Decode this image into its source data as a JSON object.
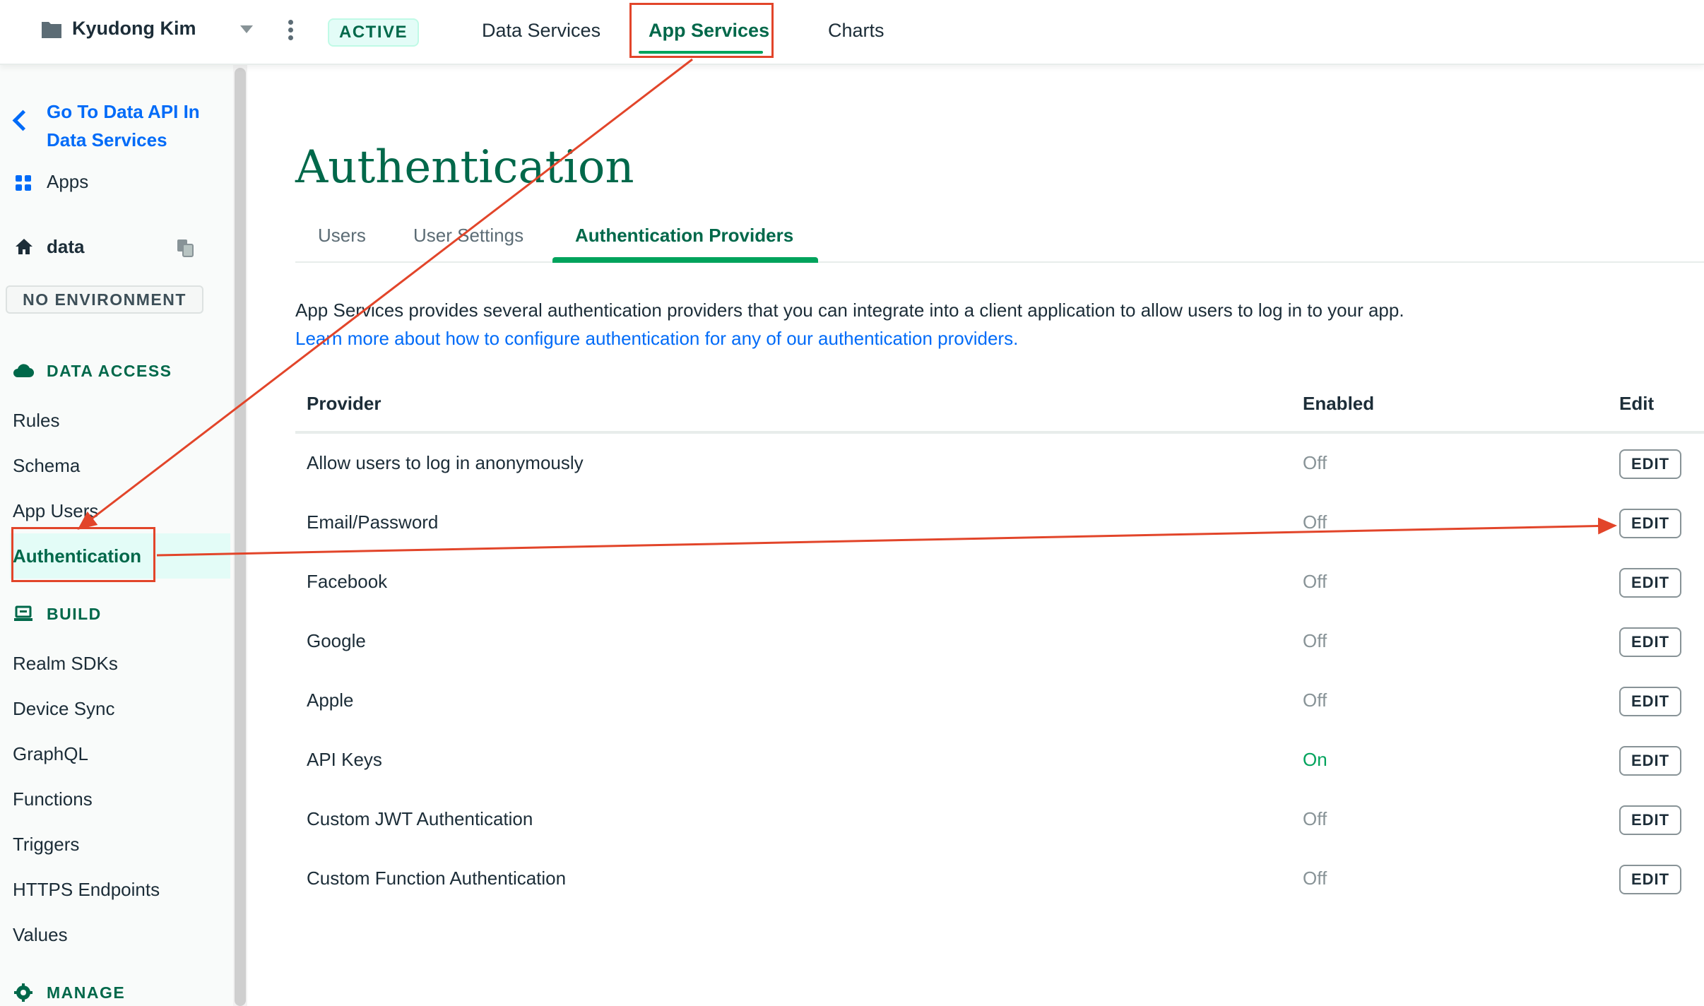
{
  "topbar": {
    "project_name": "Kyudong Kim",
    "status_badge": "ACTIVE",
    "tabs": [
      {
        "label": "Data Services"
      },
      {
        "label": "App Services"
      },
      {
        "label": "Charts"
      }
    ]
  },
  "sidebar": {
    "back_link": "Go To Data API In Data Services",
    "apps": "Apps",
    "app_name": "data",
    "environment": "NO ENVIRONMENT",
    "data_access": {
      "heading": "DATA ACCESS",
      "items": [
        "Rules",
        "Schema",
        "App Users",
        "Authentication"
      ]
    },
    "build": {
      "heading": "BUILD",
      "items": [
        "Realm SDKs",
        "Device Sync",
        "GraphQL",
        "Functions",
        "Triggers",
        "HTTPS Endpoints",
        "Values"
      ]
    },
    "manage": {
      "heading": "MANAGE"
    }
  },
  "main": {
    "title": "Authentication",
    "tabs": [
      "Users",
      "User Settings",
      "Authentication Providers"
    ],
    "description": "App Services provides several authentication providers that you can integrate into a client application to allow users to log in to your app.",
    "learn_more": "Learn more about how to configure authentication for any of our authentication providers.",
    "table": {
      "headers": {
        "provider": "Provider",
        "enabled": "Enabled",
        "edit": "Edit"
      },
      "edit_label": "EDIT",
      "rows": [
        {
          "provider": "Allow users to log in anonymously",
          "enabled": "Off"
        },
        {
          "provider": "Email/Password",
          "enabled": "Off"
        },
        {
          "provider": "Facebook",
          "enabled": "Off"
        },
        {
          "provider": "Google",
          "enabled": "Off"
        },
        {
          "provider": "Apple",
          "enabled": "Off"
        },
        {
          "provider": "API Keys",
          "enabled": "On"
        },
        {
          "provider": "Custom JWT Authentication",
          "enabled": "Off"
        },
        {
          "provider": "Custom Function Authentication",
          "enabled": "Off"
        }
      ]
    }
  },
  "colors": {
    "brand_green": "#00684a",
    "accent_green": "#00a35c",
    "link_blue": "#016bf8",
    "annotation_red": "#e2452a"
  }
}
